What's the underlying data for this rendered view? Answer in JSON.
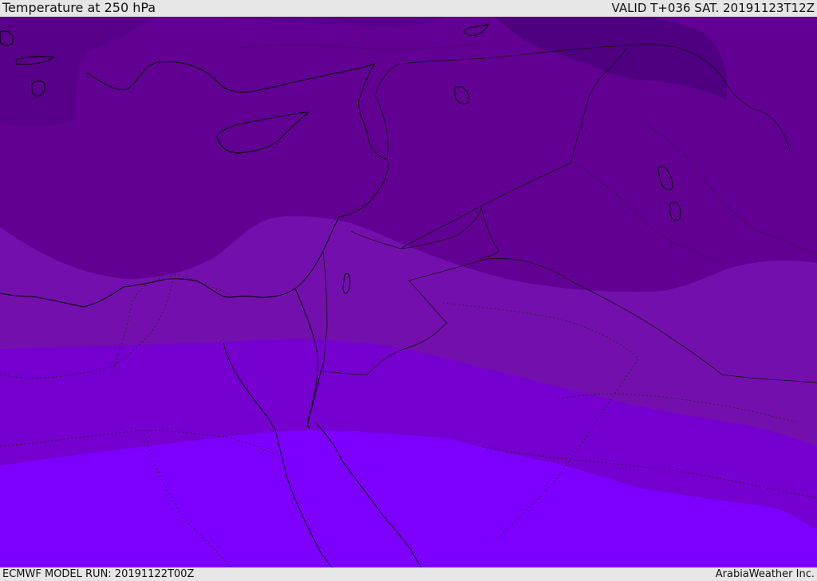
{
  "header": {
    "title": "Temperature at 250 hPa",
    "valid": "VALID T+036 SAT. 20191123T12Z"
  },
  "footer": {
    "model_run": "ECMWF MODEL RUN: 20191122T00Z",
    "credit": "ArabiaWeather Inc."
  },
  "colors": {
    "band_coldest": "#4f0080",
    "band_2": "#610093",
    "band_3": "#7310ad",
    "band_4": "#7500cf",
    "band_warmest": "#7d00ff",
    "coastline": "#000000",
    "border": "#222222"
  }
}
